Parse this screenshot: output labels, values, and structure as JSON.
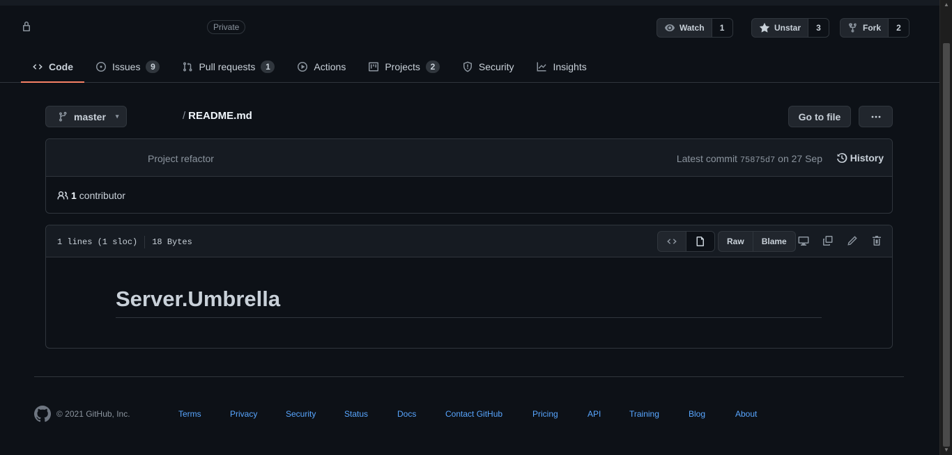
{
  "header": {
    "private_badge": "Private",
    "watch": {
      "label": "Watch",
      "count": "1"
    },
    "star": {
      "label": "Unstar",
      "count": "3"
    },
    "fork": {
      "label": "Fork",
      "count": "2"
    }
  },
  "tabs": [
    {
      "label": "Code",
      "count": null
    },
    {
      "label": "Issues",
      "count": "9"
    },
    {
      "label": "Pull requests",
      "count": "1"
    },
    {
      "label": "Actions",
      "count": null
    },
    {
      "label": "Projects",
      "count": "2"
    },
    {
      "label": "Security",
      "count": null
    },
    {
      "label": "Insights",
      "count": null
    }
  ],
  "file_nav": {
    "branch": "master",
    "separator": "/",
    "file_name": "README.md",
    "go_to_file": "Go to file"
  },
  "commit": {
    "message": "Project refactor",
    "latest_prefix": "Latest commit",
    "sha": "75875d7",
    "date": "on 27 Sep",
    "history": "History",
    "contributor_count": "1",
    "contributor_label": "contributor"
  },
  "file": {
    "lines": "1 lines (1 sloc)",
    "size": "18 Bytes",
    "raw": "Raw",
    "blame": "Blame",
    "readme_heading": "Server.Umbrella"
  },
  "footer": {
    "copyright": "© 2021 GitHub, Inc.",
    "links": [
      "Terms",
      "Privacy",
      "Security",
      "Status",
      "Docs",
      "Contact GitHub",
      "Pricing",
      "API",
      "Training",
      "Blog",
      "About"
    ]
  }
}
